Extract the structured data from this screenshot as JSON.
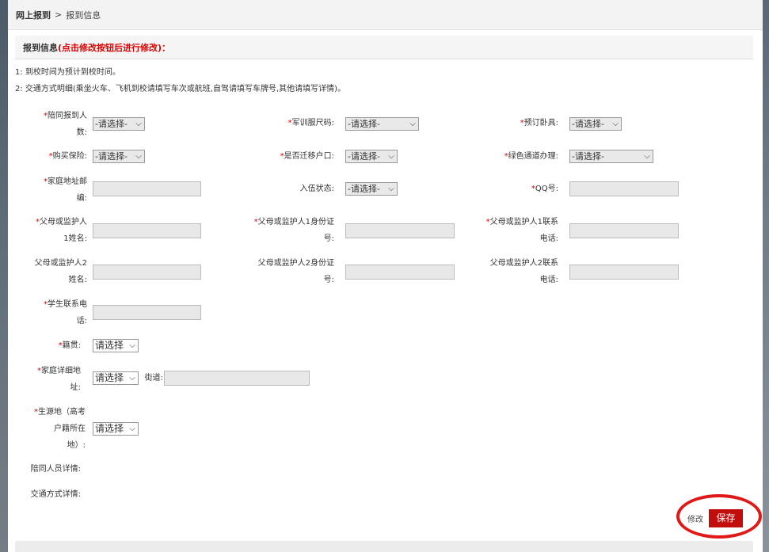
{
  "breadcrumb": {
    "home": "网上报到",
    "separator": ">",
    "current": "报到信息"
  },
  "section": {
    "title": "报到信息",
    "note": "(点击修改按钮后进行修改)："
  },
  "tips": [
    "1: 到校时间为预计到校时间。",
    "2: 交通方式明细(乘坐火车、飞机到校请填写车次或航班,自驾请填写车牌号,其他请填写详情)。"
  ],
  "fields": {
    "companions_count": {
      "label_1": "陪同报到人",
      "label_2": "数:",
      "value": "-请选择-"
    },
    "uniform_size": {
      "label": "军训服尺码:",
      "value": "-请选择-"
    },
    "bedding": {
      "label": "预订卧具:",
      "value": "-请选择-"
    },
    "insurance": {
      "label": "购买保险:",
      "value": "-请选择-"
    },
    "hukou_transfer": {
      "label": "是否迁移户口:",
      "value": "-请选择-"
    },
    "green_channel": {
      "label": "绿色通道办理:",
      "value": "-请选择-"
    },
    "postal_code": {
      "label_1": "家庭地址邮",
      "label_2": "编:",
      "value": ""
    },
    "enlistment": {
      "label": "入伍状态:",
      "value": "-请选择-"
    },
    "qq": {
      "label": "QQ号:",
      "value": ""
    },
    "guardian1_name": {
      "label_1": "父母或监护人",
      "label_2": "1姓名:",
      "value": ""
    },
    "guardian1_id": {
      "label_1": "父母或监护人1身份证",
      "label_2": "号:",
      "value": ""
    },
    "guardian1_phone": {
      "label_1": "父母或监护人1联系",
      "label_2": "电话:",
      "value": ""
    },
    "guardian2_name": {
      "label_1": "父母或监护人2",
      "label_2": "姓名:",
      "value": ""
    },
    "guardian2_id": {
      "label_1": "父母或监护人2身份证",
      "label_2": "号:",
      "value": ""
    },
    "guardian2_phone": {
      "label_1": "父母或监护人2联系",
      "label_2": "电话:",
      "value": ""
    },
    "student_phone": {
      "label_1": "学生联系电",
      "label_2": "话:",
      "value": ""
    },
    "native_place": {
      "label": "籍贯:",
      "value": "请选择"
    },
    "home_address": {
      "label_1": "家庭详细地",
      "label_2": "址:",
      "value": "请选择",
      "street_label": "街道:",
      "street_value": ""
    },
    "origin": {
      "label_1": "生源地（高考",
      "label_2": "户籍所在",
      "label_3": "地）:",
      "value": "请选择"
    },
    "companion_details": {
      "label": "陪同人员详情:"
    },
    "transport_details": {
      "label": "交通方式详情:"
    }
  },
  "required_mark": "*",
  "actions": {
    "modify": "修改",
    "save": "保存"
  },
  "colors": {
    "accent": "#c20d0d",
    "required": "#dd0000"
  }
}
